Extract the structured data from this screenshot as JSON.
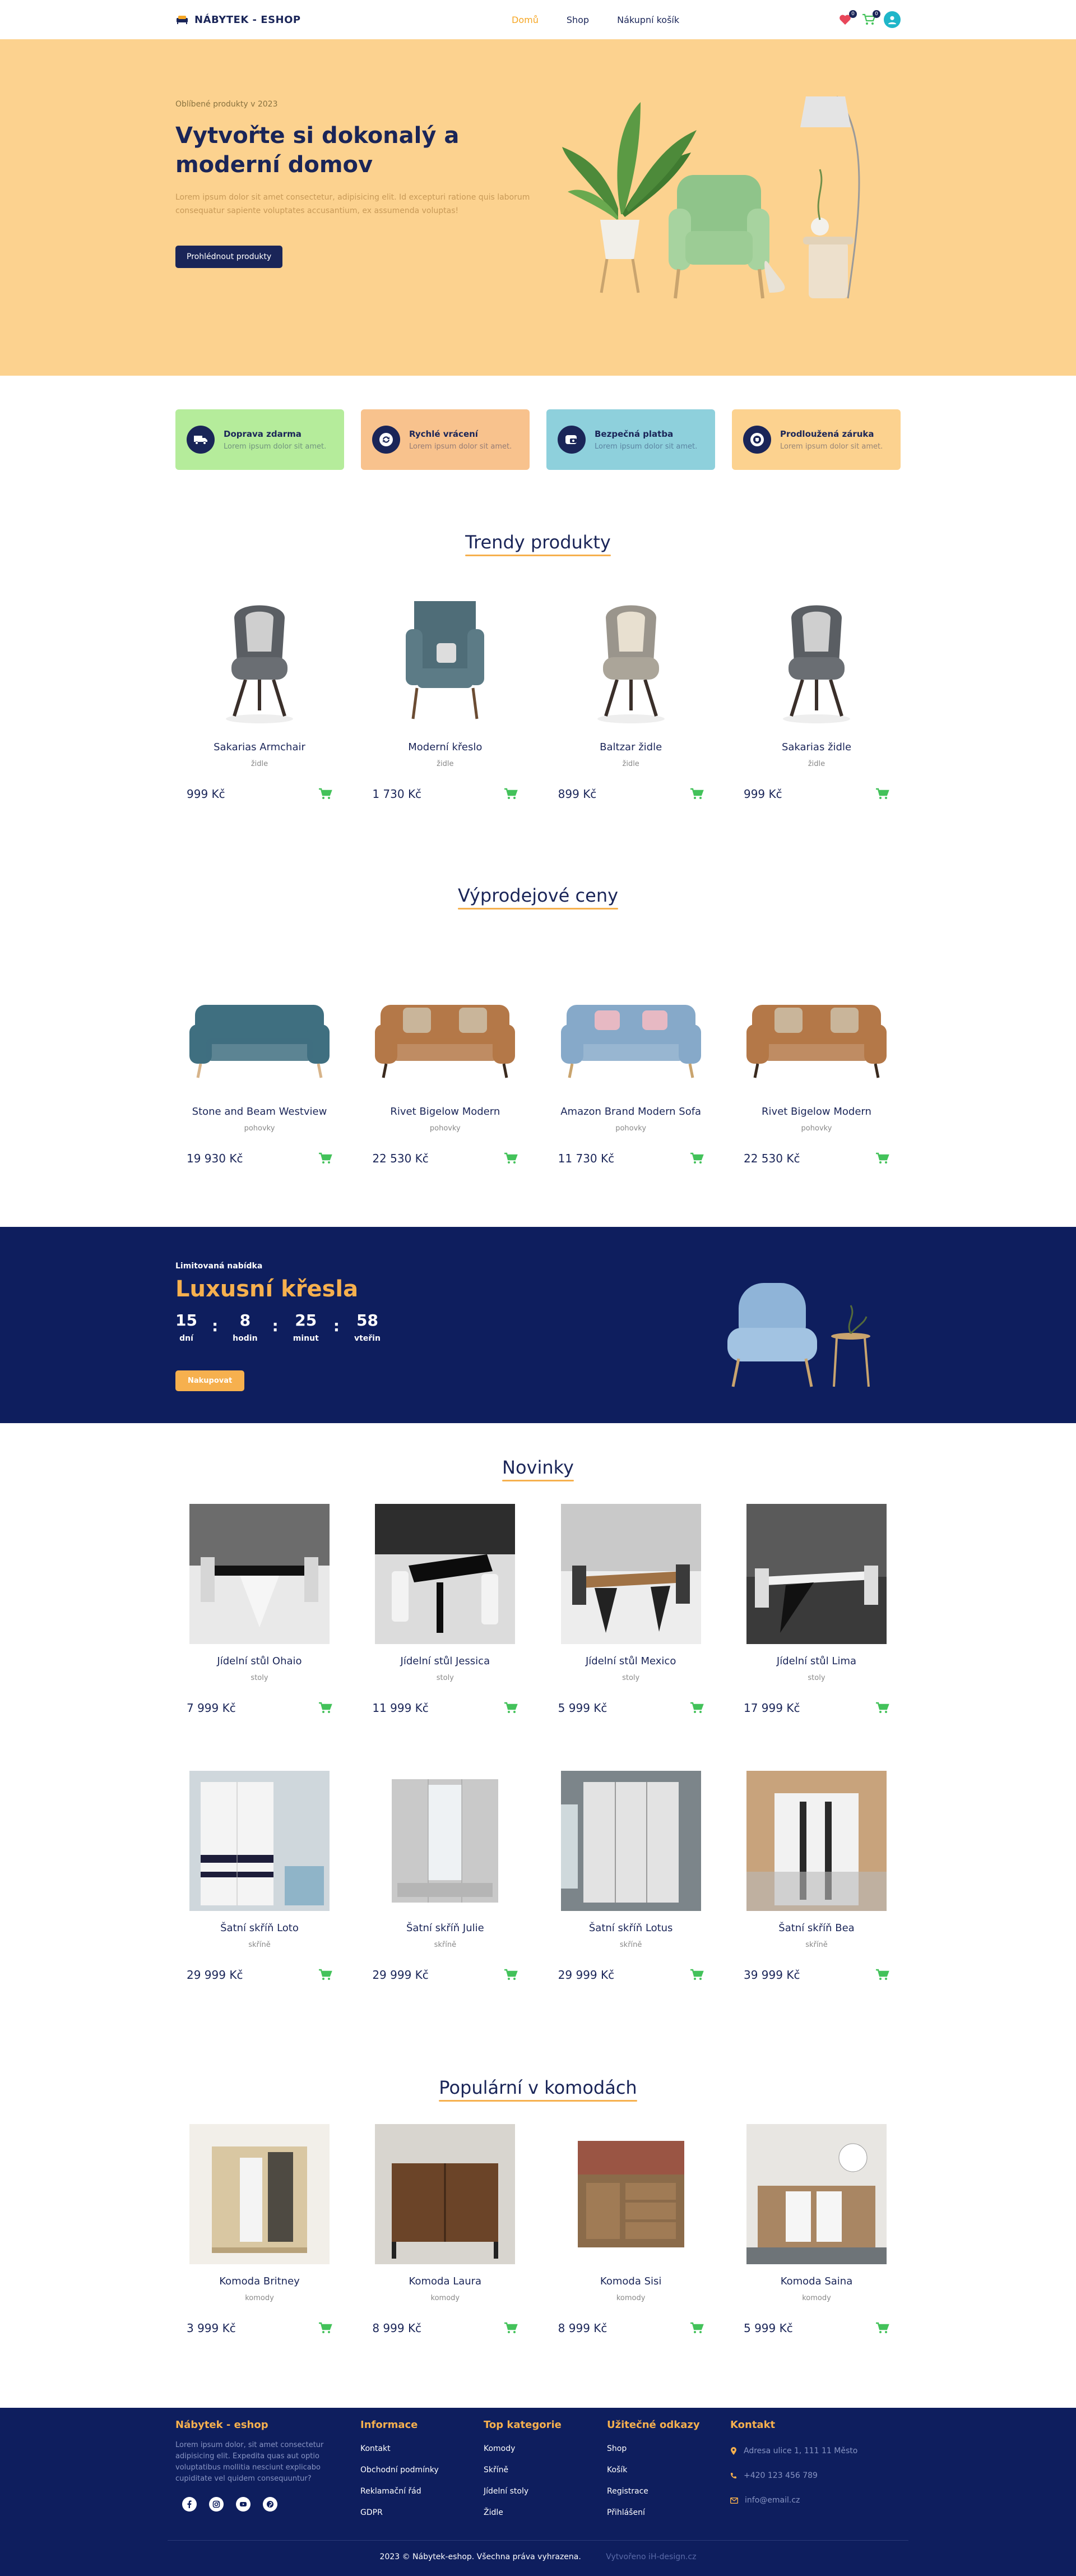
{
  "header": {
    "logo": "NÁBYTEK - ESHOP",
    "nav": [
      "Domů",
      "Shop",
      "Nákupní košík"
    ],
    "wishlist_count": "0",
    "cart_count": "0"
  },
  "hero": {
    "subtitle": "Oblíbené produkty v 2023",
    "title": "Vytvořte si dokonalý a moderní domov",
    "description": "Lorem ipsum dolor sit amet consectetur, adipisicing elit. Id excepturi ratione quis laborum consequatur sapiente voluptates accusantium, ex assumenda voluptas!",
    "button": "Prohlédnout produkty"
  },
  "features": [
    {
      "title": "Doprava zdarma",
      "desc": "Lorem ipsum dolor sit amet.",
      "color": "#b5ec9b",
      "icon": "truck-icon"
    },
    {
      "title": "Rychlé vrácení",
      "desc": "Lorem ipsum dolor sit amet.",
      "color": "#f8c28d",
      "icon": "refresh-icon"
    },
    {
      "title": "Bezpečná platba",
      "desc": "Lorem ipsum dolor sit amet.",
      "color": "#8ed0dc",
      "icon": "secure-payment-icon"
    },
    {
      "title": "Prodloužená záruka",
      "desc": "Lorem ipsum dolor sit amet.",
      "color": "#fcd28f",
      "icon": "warranty-icon"
    }
  ],
  "trending": {
    "title": "Trendy produkty",
    "items": [
      {
        "name": "Sakarias Armchair",
        "cat": "židle",
        "price": "999 Kč",
        "img": "chair-gray"
      },
      {
        "name": "Moderní křeslo",
        "cat": "židle",
        "price": "1 730 Kč",
        "img": "wingchair"
      },
      {
        "name": "Baltzar židle",
        "cat": "židle",
        "price": "899 Kč",
        "img": "chair-beige"
      },
      {
        "name": "Sakarias židle",
        "cat": "židle",
        "price": "999 Kč",
        "img": "chair-gray"
      }
    ]
  },
  "sale": {
    "title": "Výprodejové ceny",
    "items": [
      {
        "name": "Stone and Beam Westview",
        "cat": "pohovky",
        "price": "19 930 Kč",
        "img": "sofa-teal"
      },
      {
        "name": "Rivet Bigelow Modern",
        "cat": "pohovky",
        "price": "22 530 Kč",
        "img": "sofa-brown"
      },
      {
        "name": "Amazon Brand Modern Sofa",
        "cat": "pohovky",
        "price": "11 730 Kč",
        "img": "sofa-blue"
      },
      {
        "name": "Rivet Bigelow Modern",
        "cat": "pohovky",
        "price": "22 530 Kč",
        "img": "sofa-brown"
      }
    ]
  },
  "offer": {
    "label": "Limitovaná nabídka",
    "title": "Luxusní křesla",
    "timer": [
      {
        "num": "15",
        "lab": "dní"
      },
      {
        "num": "8",
        "lab": "hodin"
      },
      {
        "num": "25",
        "lab": "minut"
      },
      {
        "num": "58",
        "lab": "vteřin"
      }
    ],
    "button": "Nakupovat"
  },
  "news": {
    "title": "Novinky",
    "items": [
      {
        "name": "Jídelní stůl Ohaio",
        "cat": "stoly",
        "price": "7 999 Kč",
        "img": "table-white"
      },
      {
        "name": "Jídelní stůl Jessica",
        "cat": "stoly",
        "price": "11 999 Kč",
        "img": "table-black"
      },
      {
        "name": "Jídelní stůl Mexico",
        "cat": "stoly",
        "price": "5 999 Kč",
        "img": "table-wood"
      },
      {
        "name": "Jídelní stůl Lima",
        "cat": "stoly",
        "price": "17 999 Kč",
        "img": "table-dark"
      },
      {
        "name": "Šatní skříň Loto",
        "cat": "skříně",
        "price": "29 999 Kč",
        "img": "wardrobe-white"
      },
      {
        "name": "Šatní skříň Julie",
        "cat": "skříně",
        "price": "29 999 Kč",
        "img": "wardrobe-mirror"
      },
      {
        "name": "Šatní skříň Lotus",
        "cat": "skříně",
        "price": "29 999 Kč",
        "img": "wardrobe-sliding"
      },
      {
        "name": "Šatní skříň Bea",
        "cat": "skříně",
        "price": "39 999 Kč",
        "img": "wardrobe-wood"
      }
    ]
  },
  "dressers": {
    "title": "Populární v komodách",
    "items": [
      {
        "name": "Komoda Britney",
        "cat": "komody",
        "price": "3 999 Kč",
        "img": "dresser-light"
      },
      {
        "name": "Komoda Laura",
        "cat": "komody",
        "price": "8 999 Kč",
        "img": "dresser-walnut"
      },
      {
        "name": "Komoda Sisi",
        "cat": "komody",
        "price": "8 999 Kč",
        "img": "dresser-rustic"
      },
      {
        "name": "Komoda Saina",
        "cat": "komody",
        "price": "5 999 Kč",
        "img": "dresser-white"
      }
    ]
  },
  "footer": {
    "brand": "Nábytek - eshop",
    "about": "Lorem ipsum dolor, sit amet consectetur adipisicing elit. Expedita quas aut optio voluptatibus mollitia nesciunt explicabo cupiditate vel quidem consequuntur?",
    "info_title": "Informace",
    "info": [
      "Kontakt",
      "Obchodní podmínky",
      "Reklamační řád",
      "GDPR"
    ],
    "cat_title": "Top kategorie",
    "cats": [
      "Komody",
      "Skříně",
      "Jídelní stoly",
      "Židle"
    ],
    "links_title": "Užitečné odkazy",
    "links": [
      "Shop",
      "Košík",
      "Registrace",
      "Přihlášení"
    ],
    "contact_title": "Kontakt",
    "address": "Adresa ulice 1, 111 11 Město",
    "phone": "+420 123 456 789",
    "email": "info@email.cz",
    "copyright": "2023 © Nábytek-eshop. Všechna práva vyhrazena.",
    "made_by": "Vytvořeno iH-design.cz"
  },
  "colors": {
    "navy": "#1a2558",
    "hero_bg": "#fcd28f",
    "accent": "#f6a623",
    "cart_green": "#43c25a",
    "footer_bg": "#0e1e5e"
  }
}
